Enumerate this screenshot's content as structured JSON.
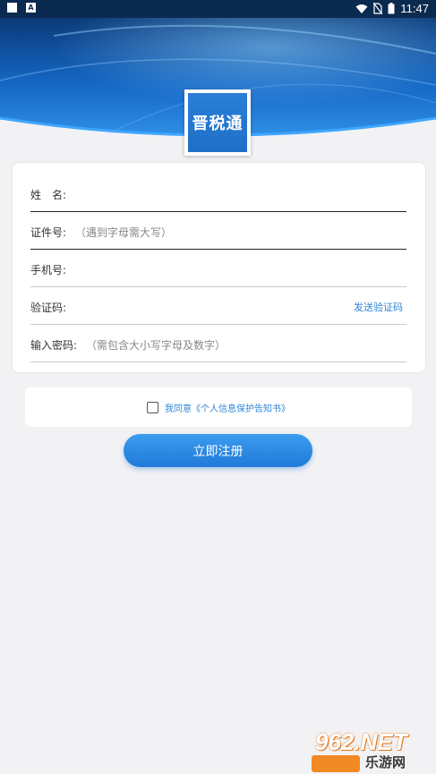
{
  "status_bar": {
    "time": "11:47"
  },
  "app": {
    "logo_text": "晋税通"
  },
  "form": {
    "name_label": "姓　名:",
    "id_label": "证件号:",
    "id_hint": "（遇到字母需大写）",
    "phone_label": "手机号:",
    "code_label": "验证码:",
    "send_code": "发送验证码",
    "password_label": "输入密码:",
    "password_hint": "（需包含大小写字母及数字）"
  },
  "agreement": {
    "text": "我同意《个人信息保护告知书》"
  },
  "submit_label": "立即注册",
  "watermark": {
    "top": "962.NET",
    "bottom": "乐游网"
  },
  "colors": {
    "accent": "#2f86d8",
    "button": "#2a86e4",
    "header": "#1466c4"
  }
}
